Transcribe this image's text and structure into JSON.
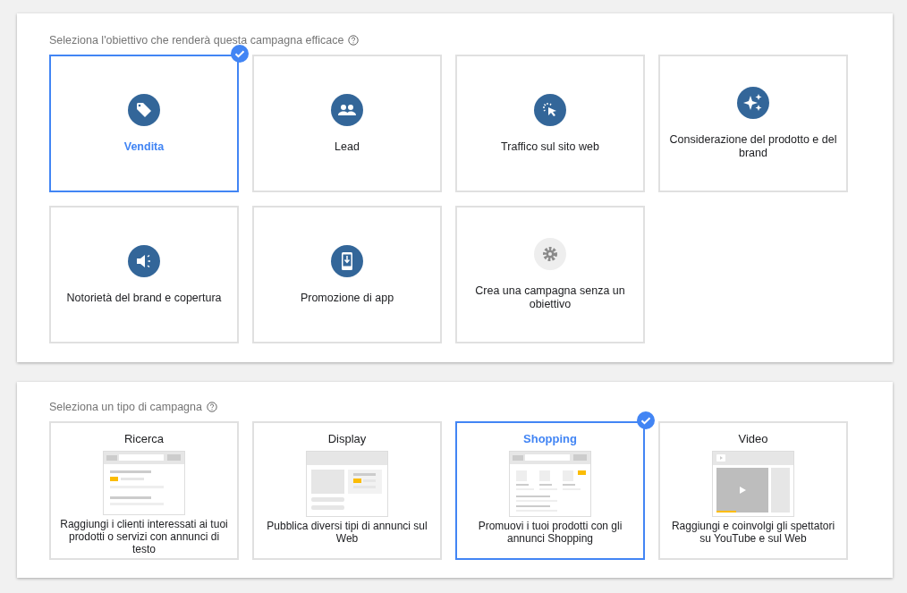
{
  "objective_section": {
    "heading": "Seleziona l'obiettivo che renderà questa campagna efficace",
    "goals": [
      {
        "label": "Vendita",
        "kind": "tag",
        "selected": true
      },
      {
        "label": "Lead",
        "kind": "people",
        "selected": false
      },
      {
        "label": "Traffico sul sito web",
        "kind": "click",
        "selected": false
      },
      {
        "label": "Considerazione del prodotto e del brand",
        "kind": "sparkle",
        "selected": false
      },
      {
        "label": "Notorietà del brand e copertura",
        "kind": "megaphone",
        "selected": false
      },
      {
        "label": "Promozione di app",
        "kind": "phone",
        "selected": false
      },
      {
        "label": "Crea una campagna senza un obiettivo",
        "kind": "gear",
        "selected": false
      }
    ]
  },
  "campaign_type_section": {
    "heading": "Seleziona un tipo di campagna",
    "types": [
      {
        "title": "Ricerca",
        "description": "Raggiungi i clienti interessati ai tuoi prodotti o servizi con annunci di testo",
        "kind": "search",
        "selected": false
      },
      {
        "title": "Display",
        "description": "Pubblica diversi tipi di annunci sul Web",
        "kind": "display",
        "selected": false
      },
      {
        "title": "Shopping",
        "description": "Promuovi i tuoi prodotti con gli annunci Shopping",
        "kind": "shopping",
        "selected": true
      },
      {
        "title": "Video",
        "description": "Raggiungi e coinvolgi gli spettatori su YouTube e sul Web",
        "kind": "video",
        "selected": false
      }
    ]
  }
}
